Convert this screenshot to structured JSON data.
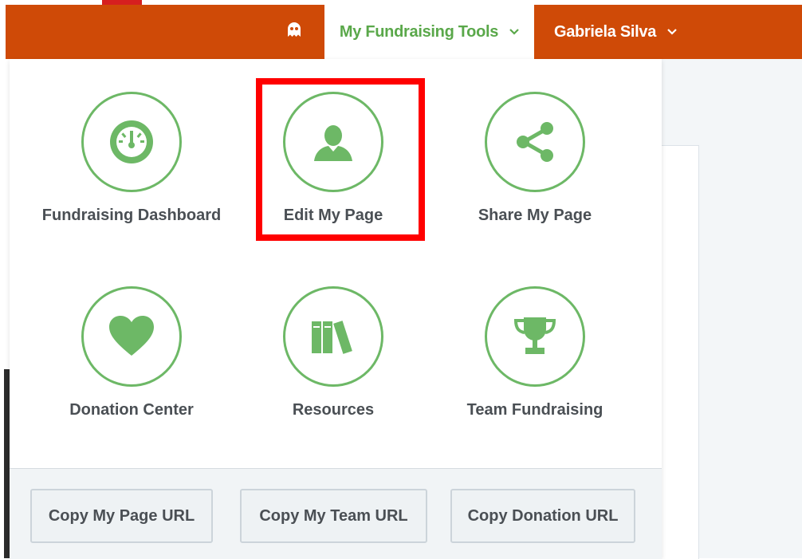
{
  "header": {
    "tools_label": "My Fundraising Tools",
    "user_name": "Gabriela Silva",
    "ghost_icon": "ghost-icon",
    "chevron_icon": "chevron-down-icon"
  },
  "menu": {
    "tiles": [
      {
        "label": "Fundraising Dashboard",
        "icon": "gauge-icon"
      },
      {
        "label": "Edit My Page",
        "icon": "user-icon"
      },
      {
        "label": "Share My Page",
        "icon": "share-icon"
      },
      {
        "label": "Donation Center",
        "icon": "heart-icon"
      },
      {
        "label": "Resources",
        "icon": "books-icon"
      },
      {
        "label": "Team Fundraising",
        "icon": "trophy-icon"
      }
    ],
    "highlighted_tile": "Edit My Page"
  },
  "footer": {
    "buttons": [
      {
        "label": "Copy My Page URL"
      },
      {
        "label": "Copy My Team URL"
      },
      {
        "label": "Copy Donation URL"
      }
    ]
  },
  "colors": {
    "header_bg": "#cf4a07",
    "accent_green": "#6db866",
    "highlight_red": "#ff0000"
  }
}
